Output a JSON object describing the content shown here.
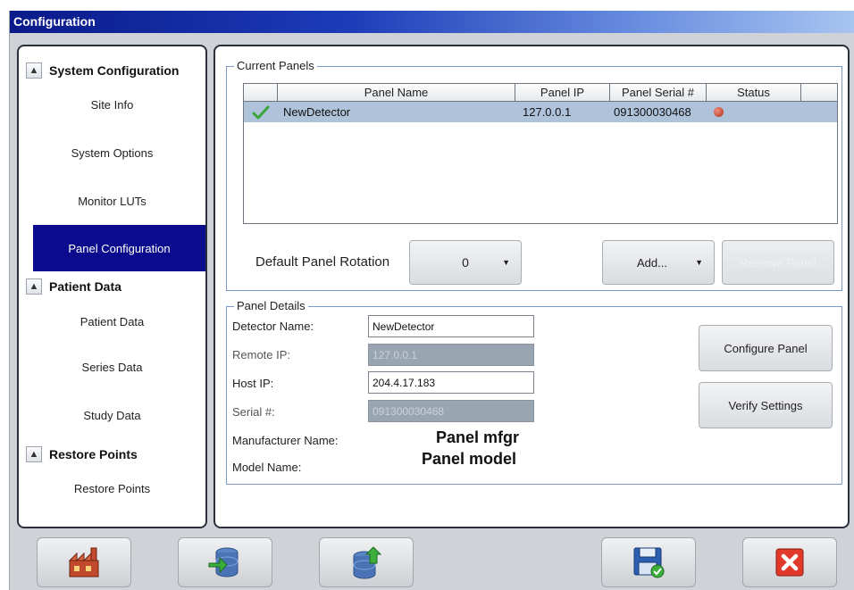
{
  "window": {
    "title": "Configuration"
  },
  "nav": {
    "sections": [
      {
        "title": "System Configuration",
        "items": [
          "Site Info",
          "System Options",
          "Monitor LUTs",
          "Panel Configuration"
        ]
      },
      {
        "title": "Patient Data",
        "items": [
          "Patient Data",
          "Series Data",
          "Study Data"
        ]
      },
      {
        "title": "Restore Points",
        "items": [
          "Restore Points"
        ]
      }
    ],
    "active": "Panel Configuration"
  },
  "current_panels": {
    "legend": "Current Panels",
    "columns": [
      "Panel Name",
      "Panel IP",
      "Panel Serial #",
      "Status"
    ],
    "rows": [
      {
        "name": "NewDetector",
        "ip": "127.0.0.1",
        "serial": "091300030468",
        "status_color": "#c0392b",
        "selected": true
      }
    ],
    "rotation_label": "Default Panel Rotation",
    "rotation_value": "0",
    "add_label": "Add...",
    "remove_label": "Remove Panel"
  },
  "panel_details": {
    "legend": "Panel Details",
    "detector_name_label": "Detector Name:",
    "detector_name_value": "NewDetector",
    "remote_ip_label": "Remote IP:",
    "remote_ip_value": "127.0.0.1",
    "host_ip_label": "Host IP:",
    "host_ip_value": "204.4.17.183",
    "serial_label": "Serial #:",
    "serial_value": "091300030468",
    "manufacturer_label": "Manufacturer Name:",
    "manufacturer_value": "Panel mfgr",
    "model_label": "Model Name:",
    "model_value": "Panel model",
    "configure_label": "Configure Panel",
    "verify_label": "Verify Settings"
  },
  "toolbar": {
    "buttons": [
      "factory-icon",
      "database-import-icon",
      "database-export-icon",
      "save-icon",
      "close-icon"
    ]
  },
  "colors": {
    "accent": "#0b0b8e",
    "selection": "#aec2da",
    "status_error": "#c0392b",
    "check": "#3aa63a"
  }
}
